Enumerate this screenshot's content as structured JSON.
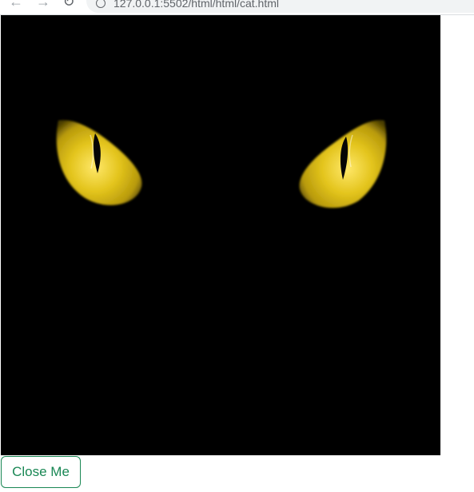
{
  "browser": {
    "url": "127.0.0.1:5502/html/html/cat.html",
    "back_icon": "back-arrow-icon",
    "forward_icon": "forward-arrow-icon",
    "reload_icon": "reload-icon",
    "info_icon": "site-info-icon"
  },
  "page": {
    "image": {
      "subject": "cat-eyes",
      "background_color": "#000000",
      "eye_color": "#e0c21a"
    },
    "close_button": {
      "label": "Close Me",
      "color": "#198754"
    }
  }
}
